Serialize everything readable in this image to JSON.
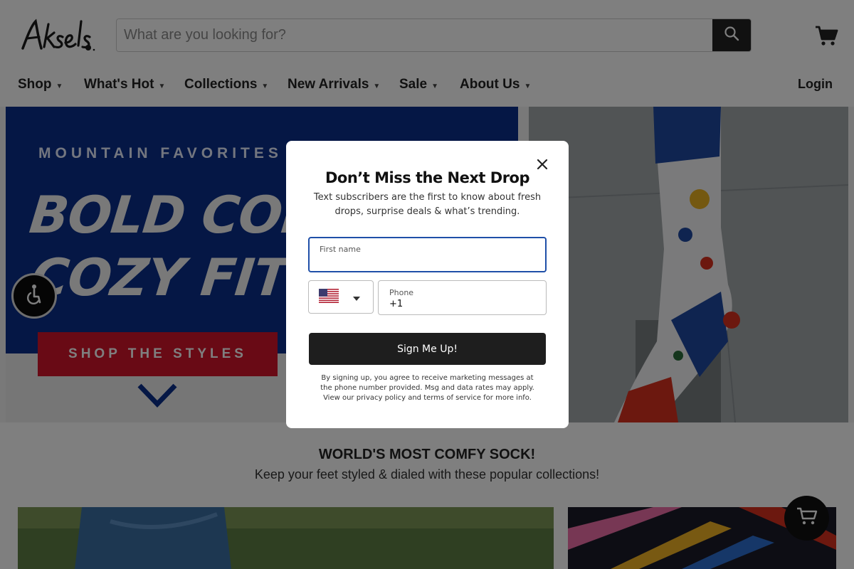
{
  "header": {
    "search_placeholder": "What are you looking for?"
  },
  "nav": {
    "items": [
      {
        "label": "Shop"
      },
      {
        "label": "What's Hot"
      },
      {
        "label": "Collections"
      },
      {
        "label": "New Arrivals"
      },
      {
        "label": "Sale"
      },
      {
        "label": "About Us"
      }
    ],
    "login": "Login"
  },
  "hero": {
    "eyebrow": "MOUNTAIN FAVORITES",
    "headline_1": "BOLD COLORS",
    "headline_2": "COZY FITS",
    "cta": "SHOP THE STYLES"
  },
  "collections": {
    "title": "WORLD'S MOST COMFY SOCK!",
    "subtitle": "Keep your feet styled & dialed with these popular collections!"
  },
  "modal": {
    "title": "Don’t Miss the Next Drop",
    "subtitle": "Text subscribers are the first to know about fresh drops, surprise deals & what’s trending.",
    "first_name_label": "First name",
    "phone_label": "Phone",
    "phone_value": "+1",
    "submit": "Sign Me Up!",
    "disclaimer": "By signing up, you agree to receive marketing messages at the phone number provided. Msg and data rates may apply. View our privacy policy and terms of service for more info."
  },
  "colors": {
    "hero_blue": "#0b2f8a",
    "cta_red": "#d3142a",
    "field_focus": "#1f4fa8",
    "button_dark": "#1e1e1e"
  },
  "icons": [
    "search-icon",
    "cart-icon",
    "chevron-down-icon",
    "accessibility-icon",
    "close-icon",
    "us-flag-icon"
  ]
}
